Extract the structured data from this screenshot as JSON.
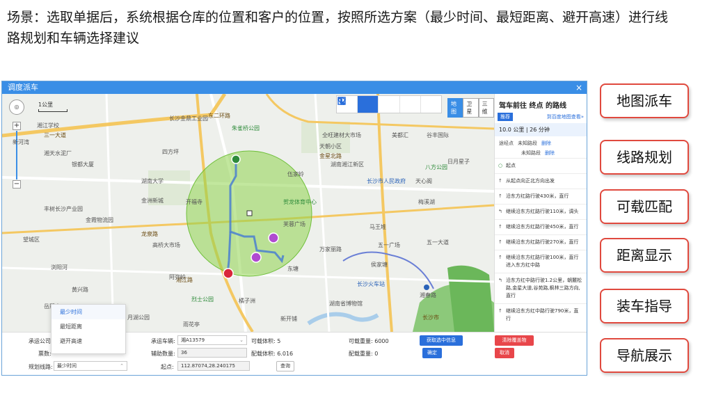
{
  "headline": "场景：选取单据后，系统根据仓库的位置和客户的位置，按照所选方案（最少时间、最短距离、避开高速）进行线路规划和车辆选择建议",
  "window": {
    "title": "调度派车",
    "close": "×"
  },
  "map": {
    "scale_label": "1公里",
    "nav_label": "◎",
    "zoom_in": "+",
    "zoom_out": "−",
    "toolbar": [
      "hand-icon",
      "circle-icon",
      "route-icon",
      "diamond-icon",
      "square-icon"
    ],
    "map_types": [
      "地图",
      "卫星",
      "三维"
    ],
    "map_type_selected": "地图",
    "road_labels": [
      "东二环路",
      "金星北路",
      "龙泉路",
      "三一大道",
      "湘江路",
      "长沙市"
    ],
    "pois": [
      {
        "t": "湘江学校"
      },
      {
        "t": "新河湾"
      },
      {
        "t": "长沙金鼎工业园"
      },
      {
        "t": "金洲新城"
      },
      {
        "t": "朱雀桥公园"
      },
      {
        "t": "全旺建材大市场"
      },
      {
        "t": "天朝小区"
      },
      {
        "t": "美都汇"
      },
      {
        "t": "湖南湘江新区"
      },
      {
        "t": "谷丰国际"
      },
      {
        "t": "湘天水泥厂"
      },
      {
        "t": "银都大厦"
      },
      {
        "t": "四方坪"
      },
      {
        "t": "八方公园"
      },
      {
        "t": "日月星子"
      },
      {
        "t": "伍家岭"
      },
      {
        "t": "长沙市人民政府"
      },
      {
        "t": "天心阁"
      },
      {
        "t": "湖南大学"
      },
      {
        "t": "贺龙体育中心"
      },
      {
        "t": "丰树长沙产业园"
      },
      {
        "t": "金霞物流园"
      },
      {
        "t": "开福寺"
      },
      {
        "t": "芙蓉广场"
      },
      {
        "t": "马王堆"
      },
      {
        "t": "梅溪湖"
      },
      {
        "t": "望城区"
      },
      {
        "t": "高桥大市场"
      },
      {
        "t": "万家丽路"
      },
      {
        "t": "五一广场"
      },
      {
        "t": "五一大道"
      },
      {
        "t": "浏阳河"
      },
      {
        "t": "东塘"
      },
      {
        "t": "侯家塘"
      },
      {
        "t": "阿弥岭"
      },
      {
        "t": "黄兴路"
      },
      {
        "t": "长沙火车站"
      },
      {
        "t": "湘春路"
      },
      {
        "t": "岳麓山"
      },
      {
        "t": "橘子洲"
      },
      {
        "t": "湖南省博物馆"
      },
      {
        "t": "烈士公园"
      },
      {
        "t": "月湖公园"
      },
      {
        "t": "新开铺"
      },
      {
        "t": "雨花亭"
      }
    ]
  },
  "route_panel": {
    "title": "驾车前往 终点 的路线",
    "recommend_tag": "推荐",
    "link": "到百度地图查看»",
    "summary": "10.0 公里 | 26 分钟",
    "via_label": "途经点",
    "vias": [
      {
        "name": "未知路段",
        "action": "删除"
      },
      {
        "name": "未知路段",
        "action": "删除"
      }
    ],
    "steps": [
      {
        "icon": "○",
        "text": "起点"
      },
      {
        "icon": "↑",
        "text": "从起点向正北方向出发"
      },
      {
        "icon": "↑",
        "text": "沿东方红路行驶430米，直行"
      },
      {
        "icon": "↰",
        "text": "继续沿东方红路行驶110米，调头"
      },
      {
        "icon": "↑",
        "text": "继续沿东方红路行驶450米，直行"
      },
      {
        "icon": "↑",
        "text": "继续沿东方红路行驶270米，直行"
      },
      {
        "icon": "↑",
        "text": "继续沿东方红路行驶100米，直行进入东方红中路"
      },
      {
        "icon": "↰",
        "text": "沿东方红中路行驶1.2公里，朝麓松路,金星大道,谷苑路,枫林三路方向,直行"
      },
      {
        "icon": "↑",
        "text": "继续沿东方红中路行驶790米，直行"
      }
    ]
  },
  "form": {
    "carrier_label": "承运公司:",
    "vehicle_label": "承运车辆:",
    "vehicle_value": "湘A13579",
    "volume_label": "可载体积: 5",
    "weight_label": "可载重量: 6000",
    "count_label": "票数:",
    "aux_label": "辅助数量:",
    "aux_value": "36",
    "cfg_volume_label": "配载体积: 6.016",
    "cfg_weight_label": "配载重量: 0",
    "route_label": "规划线路:",
    "route_value": "最少时间",
    "start_label": "起点:",
    "start_value": "112.87074,28.240175",
    "btn_get": "获取选中信息",
    "btn_confirm": "确定",
    "btn_clear": "清除覆盖物",
    "btn_cancel": "取消",
    "btn_query": "查询",
    "options": [
      "最少时间",
      "最短距离",
      "避开高速"
    ]
  },
  "features": [
    "地图派车",
    "线路规划",
    "可载匹配",
    "距离显示",
    "装车指导",
    "导航展示"
  ],
  "colors": {
    "accent": "#2a6fdb",
    "danger": "#e8464a",
    "feature_border": "#e0493e",
    "circle": "#8fd44f"
  }
}
